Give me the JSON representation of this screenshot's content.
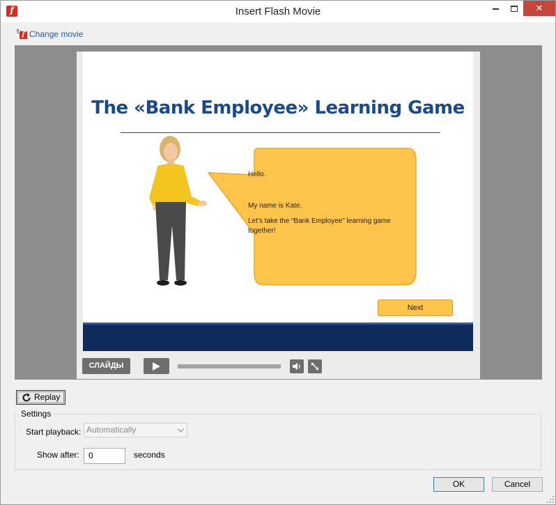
{
  "window": {
    "title": "Insert Flash Movie",
    "app_icon_glyph": "f",
    "close_glyph": "✕"
  },
  "toolbar": {
    "change_movie_label": "Change movie",
    "change_icon": "flash-file-icon"
  },
  "slide": {
    "title": "The «Bank Employee» Learning Game",
    "bubble": {
      "line1": "Hello.",
      "line2": "My name is Kate.",
      "line3": "Let’s take the “Bank Employee” learning game together!"
    },
    "next_label": "Next"
  },
  "player": {
    "slides_label": "СЛАЙДЫ",
    "progress": 0
  },
  "replay_label": "Replay",
  "settings": {
    "group_label": "Settings",
    "start_playback_label": "Start playback:",
    "start_playback_value": "Automatically",
    "show_after_label": "Show after:",
    "show_after_value": "0",
    "seconds_label": "seconds"
  },
  "buttons": {
    "ok_label": "OK",
    "cancel_label": "Cancel"
  },
  "colors": {
    "title_blue": "#1a4a8a",
    "bubble_fill": "#ffc44b",
    "footer_navy": "#0f2b5c",
    "link_blue": "#1b5db8",
    "close_red": "#c7453b"
  }
}
